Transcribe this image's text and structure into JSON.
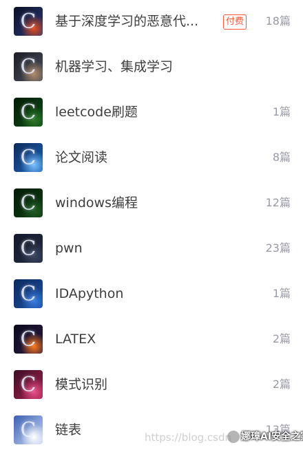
{
  "columns": [
    {
      "name": "基于深度学习的恶意代...",
      "badge": "付费",
      "count": "18篇",
      "thumb_icon": "c-logo-icon",
      "thumb_colors": [
        "#0a0f25",
        "#2b3a78",
        "#e34b1c"
      ]
    },
    {
      "name": "机器学习、集成学习",
      "count": "",
      "thumb_icon": "c-logo-icon",
      "thumb_colors": [
        "#1b1d24",
        "#4b4f5c",
        "#b08a6a"
      ]
    },
    {
      "name": "leetcode刷题",
      "count": "1篇",
      "thumb_icon": "c-logo-icon",
      "thumb_colors": [
        "#041a06",
        "#0f4d16",
        "#2f7a2a"
      ]
    },
    {
      "name": "论文阅读",
      "count": "8篇",
      "thumb_icon": "c-logo-icon",
      "thumb_colors": [
        "#0b2a5a",
        "#1f64b8",
        "#7bc0ff"
      ]
    },
    {
      "name": "windows编程",
      "count": "12篇",
      "thumb_icon": "c-logo-icon",
      "thumb_colors": [
        "#051a08",
        "#0d3d12",
        "#225d24"
      ]
    },
    {
      "name": "pwn",
      "count": "23篇",
      "thumb_icon": "c-logo-icon",
      "thumb_colors": [
        "#141a2a",
        "#222b40",
        "#3a4560"
      ]
    },
    {
      "name": "IDApython",
      "count": "1篇",
      "thumb_icon": "c-logo-icon",
      "thumb_colors": [
        "#0b2a5e",
        "#1c4f9e",
        "#3a7be0"
      ]
    },
    {
      "name": "LATEX",
      "count": "2篇",
      "thumb_icon": "c-logo-icon",
      "thumb_colors": [
        "#0a0a1e",
        "#2c1a40",
        "#ff7a1a"
      ]
    },
    {
      "name": "模式识别",
      "count": "2篇",
      "thumb_icon": "c-logo-icon",
      "thumb_colors": [
        "#3a0f24",
        "#a8204e",
        "#e84f8a"
      ]
    },
    {
      "name": "链表",
      "count": "13篇",
      "thumb_icon": "c-logo-icon",
      "thumb_colors": [
        "#3a5fb0",
        "#c9d8f5",
        "#ffffff"
      ]
    }
  ],
  "watermark": {
    "url_text": "https://blog.csdn",
    "brand_text": "娜璋AI安全之家"
  }
}
